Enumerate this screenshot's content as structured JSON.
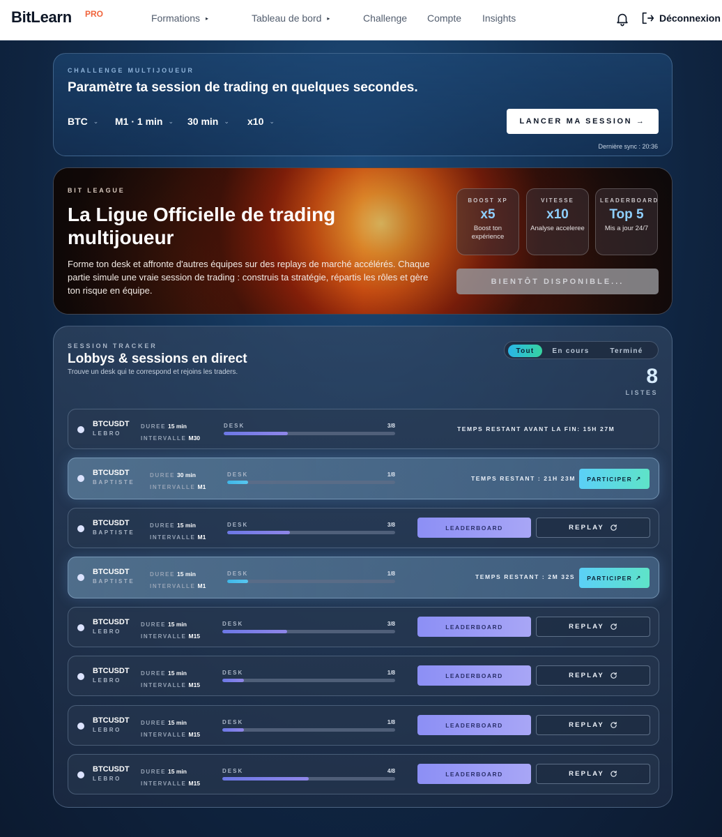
{
  "nav": {
    "logo": "BitLearn",
    "logo_badge": "PRO",
    "items": [
      {
        "label": "Formations",
        "has_caret": true
      },
      {
        "label": "Tableau de bord",
        "has_caret": true
      },
      {
        "label": "Challenge",
        "has_caret": false
      },
      {
        "label": "Compte",
        "has_caret": false
      },
      {
        "label": "Insights",
        "has_caret": false
      }
    ],
    "caret": "▸",
    "logout_label": "Déconnexion"
  },
  "setup": {
    "eyebrow": "CHALLENGE MULTIJOUEUR",
    "title": "Paramètre ta session de trading en quelques secondes.",
    "selects": [
      {
        "value": "BTC"
      },
      {
        "value": "M1 · 1 min"
      },
      {
        "value": "30 min"
      },
      {
        "value": "x10"
      }
    ],
    "chevron": "⌄",
    "launch_label": "LANCER MA SESSION →",
    "sync_text": "Dernière sync : 20:36"
  },
  "league": {
    "eyebrow": "BIT LEAGUE",
    "title": "La Ligue Officielle de trading multijoueur",
    "description": "Forme ton desk et affronte d'autres équipes sur des replays de marché accélérés. Chaque partie simule une vraie session de trading : construis ta stratégie, répartis les rôles et gère ton risque en équipe.",
    "stats": [
      {
        "label": "BOOST XP",
        "value": "x5",
        "sub": "Boost ton expérience"
      },
      {
        "label": "VITESSE",
        "value": "x10",
        "sub": "Analyse acceleree"
      },
      {
        "label": "LEADERBOARD",
        "value": "Top 5",
        "sub": "Mis a jour 24/7"
      }
    ],
    "soon_label": "BIENTÔT DISPONIBLE..."
  },
  "tracker": {
    "eyebrow": "SESSION TRACKER",
    "title": "Lobbys & sessions en direct",
    "subtitle": "Trouve un desk qui te correspond et rejoins les traders.",
    "filters": [
      "Tout",
      "En cours",
      "Terminé"
    ],
    "active_filter": "Tout",
    "count": "8",
    "count_label": "LISTES",
    "labels": {
      "duration": "DUREE",
      "interval": "INTERVALLE",
      "desk": "DESK",
      "join": "PARTICIPER",
      "join_icon": "↗",
      "leaderboard": "LEADERBOARD",
      "replay": "REPLAY"
    },
    "rows": [
      {
        "pair": "BTCUSDT",
        "owner": "LEBRO",
        "duration": "15 min",
        "interval": "M30",
        "desk": "3/8",
        "fill": 0.375,
        "status": "TEMPS RESTANT AVANT LA FIN: 15H 27M"
      },
      {
        "pair": "BTCUSDT",
        "owner": "BAPTISTE",
        "duration": "30 min",
        "interval": "M1",
        "desk": "1/8",
        "fill": 0.125,
        "status": "TEMPS RESTANT : 21H 23M"
      },
      {
        "pair": "BTCUSDT",
        "owner": "BAPTISTE",
        "duration": "15 min",
        "interval": "M1",
        "desk": "3/8",
        "fill": 0.375
      },
      {
        "pair": "BTCUSDT",
        "owner": "BAPTISTE",
        "duration": "15 min",
        "interval": "M1",
        "desk": "1/8",
        "fill": 0.125,
        "status": "TEMPS RESTANT : 2M 32S"
      },
      {
        "pair": "BTCUSDT",
        "owner": "LEBRO",
        "duration": "15 min",
        "interval": "M15",
        "desk": "3/8",
        "fill": 0.375
      },
      {
        "pair": "BTCUSDT",
        "owner": "LEBRO",
        "duration": "15 min",
        "interval": "M15",
        "desk": "1/8",
        "fill": 0.125
      },
      {
        "pair": "BTCUSDT",
        "owner": "LEBRO",
        "duration": "15 min",
        "interval": "M15",
        "desk": "1/8",
        "fill": 0.125
      },
      {
        "pair": "BTCUSDT",
        "owner": "LEBRO",
        "duration": "15 min",
        "interval": "M15",
        "desk": "4/8",
        "fill": 0.5
      }
    ]
  }
}
